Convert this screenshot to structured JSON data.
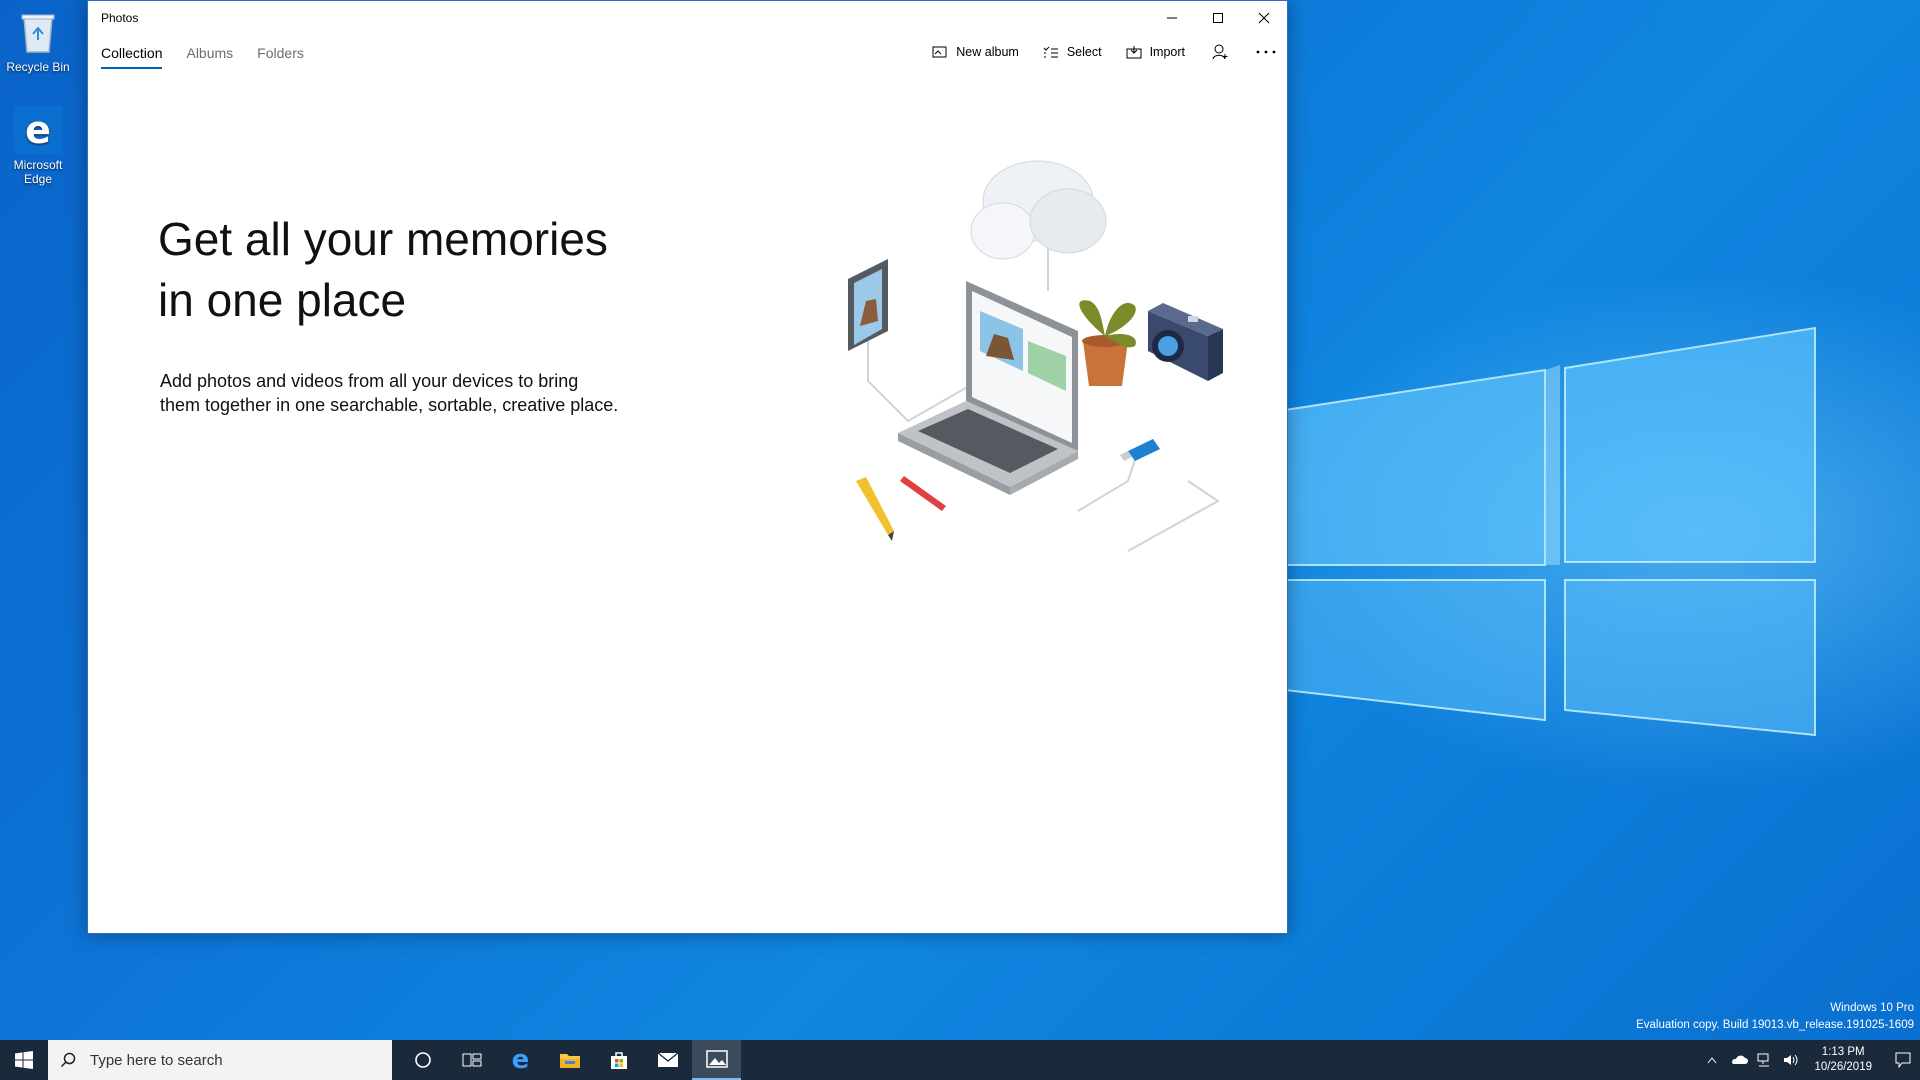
{
  "desktop": {
    "icons": [
      {
        "label": "Recycle Bin"
      },
      {
        "label": "Microsoft Edge"
      }
    ],
    "watermark": {
      "line1": "Windows 10 Pro",
      "line2": "Evaluation copy. Build 19013.vb_release.191025-1609"
    }
  },
  "window": {
    "title": "Photos",
    "tabs": [
      {
        "label": "Collection",
        "active": true
      },
      {
        "label": "Albums",
        "active": false
      },
      {
        "label": "Folders",
        "active": false
      }
    ],
    "toolbar": {
      "new_album": "New album",
      "select": "Select",
      "import": "Import"
    },
    "hero": {
      "title_line1": "Get all your memories",
      "title_line2": "in one place",
      "body_line1": "Add photos and videos from all your devices to bring",
      "body_line2": "them together in one searchable, sortable, creative place."
    }
  },
  "taskbar": {
    "search_placeholder": "Type here to search",
    "time": "1:13 PM",
    "date": "10/26/2019",
    "apps": [
      "cortana-icon",
      "task-view-icon",
      "edge-icon",
      "file-explorer-icon",
      "store-icon",
      "mail-icon",
      "photos-icon"
    ]
  },
  "colors": {
    "accent": "#0063b1",
    "desktop": "#0d74d6",
    "taskbar": "#1b2a3a"
  }
}
